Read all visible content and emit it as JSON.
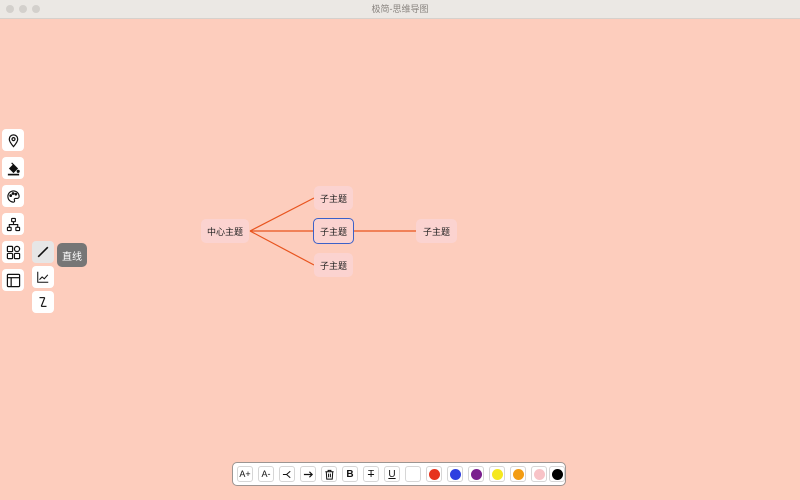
{
  "window": {
    "title": "极简-思维导图"
  },
  "mindmap": {
    "center": {
      "label": "中心主题"
    },
    "children": [
      {
        "label": "子主题"
      },
      {
        "label": "子主题"
      },
      {
        "label": "子主题"
      }
    ],
    "grandchild": {
      "label": "子主题"
    },
    "connector_color": "#e8541e",
    "selection_color": "#3c61c8"
  },
  "sidebar": {
    "tools": [
      {
        "icon": "location-pin-icon"
      },
      {
        "icon": "fill-bucket-icon"
      },
      {
        "icon": "palette-icon"
      },
      {
        "icon": "hierarchy-icon"
      },
      {
        "icon": "grid-layout-icon"
      },
      {
        "icon": "panel-layout-icon"
      }
    ],
    "line_styles": [
      {
        "icon": "straight-line-icon",
        "active": true
      },
      {
        "icon": "curve-line-icon"
      },
      {
        "icon": "elbow-line-icon"
      }
    ],
    "tooltip": "直线"
  },
  "format_bar": {
    "buttons": [
      {
        "icon": "font-increase-icon",
        "label": "A+"
      },
      {
        "icon": "font-decrease-icon",
        "label": "A-"
      },
      {
        "icon": "branch-icon"
      },
      {
        "icon": "arrow-right-icon"
      },
      {
        "icon": "trash-icon"
      },
      {
        "icon": "bold-icon",
        "label": "B"
      },
      {
        "icon": "strikethrough-icon",
        "label": "T"
      },
      {
        "icon": "underline-icon",
        "label": "U"
      }
    ],
    "colors": [
      "#ffffff",
      "#e6331d",
      "#2f3fe0",
      "#7a1f8e",
      "#f5e81e",
      "#f39c12",
      "#f8c3c7",
      "#000000"
    ]
  }
}
